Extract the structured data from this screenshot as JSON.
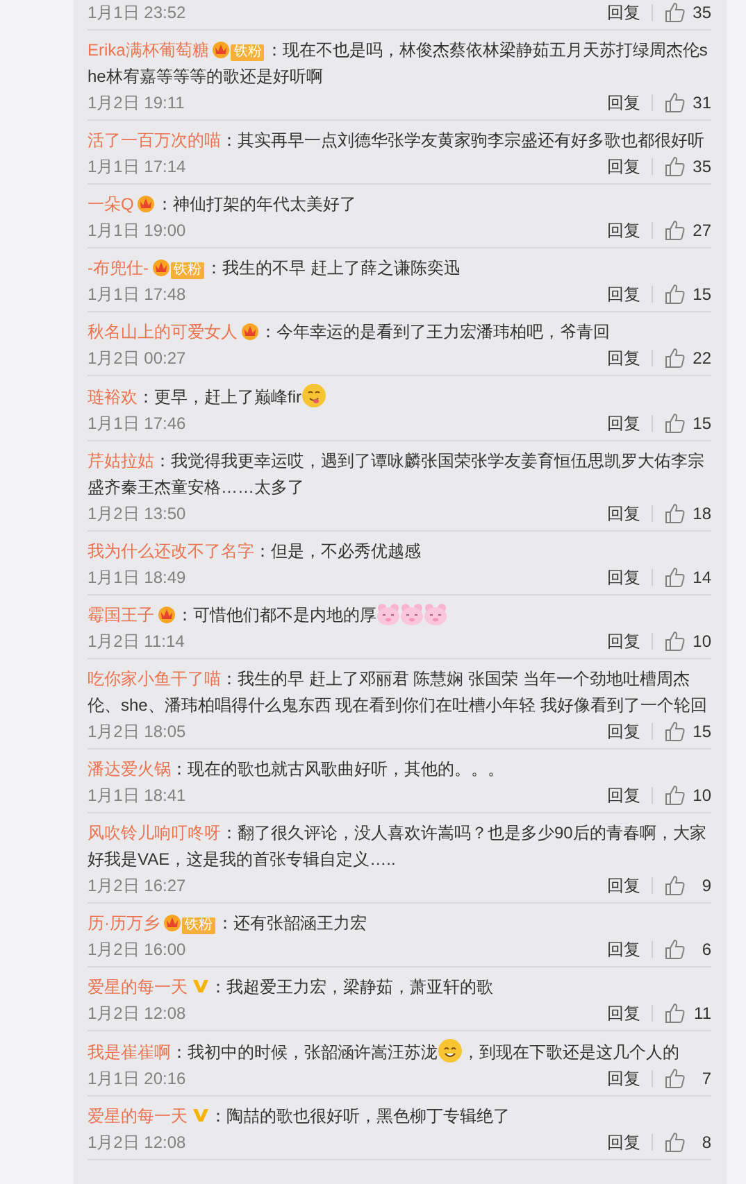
{
  "comments": [
    {
      "date": "1月1日 23:52",
      "reply": "回复",
      "likes": "35"
    },
    {
      "user": "Erika满杯葡萄糖",
      "badges": [
        {
          "kind": "crown"
        },
        {
          "kind": "fan",
          "label": "铁粉"
        }
      ],
      "body": [
        {
          "kind": "text",
          "text": "：现在不也是吗，林俊杰蔡依林梁静茹五月天苏打绿周杰伦she林宥嘉等等等的歌还是好听啊"
        }
      ],
      "date": "1月2日 19:11",
      "reply": "回复",
      "likes": "31"
    },
    {
      "user": "活了一百万次的喵",
      "body": [
        {
          "kind": "text",
          "text": "：其实再早一点刘德华张学友黄家驹李宗盛还有好多歌也都很好听"
        }
      ],
      "date": "1月1日 17:14",
      "reply": "回复",
      "likes": "35"
    },
    {
      "user": "一朵Q",
      "badges": [
        {
          "kind": "crown"
        }
      ],
      "body": [
        {
          "kind": "text",
          "text": "：神仙打架的年代太美好了"
        }
      ],
      "date": "1月1日 19:00",
      "reply": "回复",
      "likes": "27"
    },
    {
      "user": "-布兜仕-",
      "badges": [
        {
          "kind": "crown"
        },
        {
          "kind": "fan",
          "label": "铁粉"
        }
      ],
      "body": [
        {
          "kind": "text",
          "text": "：我生的不早 赶上了薛之谦陈奕迅"
        }
      ],
      "date": "1月1日 17:48",
      "reply": "回复",
      "likes": "15"
    },
    {
      "user": "秋名山上的可爱女人",
      "badges": [
        {
          "kind": "crown"
        }
      ],
      "body": [
        {
          "kind": "text",
          "text": "：今年幸运的是看到了王力宏潘玮柏吧，爷青回"
        }
      ],
      "date": "1月2日 00:27",
      "reply": "回复",
      "likes": "22"
    },
    {
      "user": "琏裕欢",
      "body": [
        {
          "kind": "text",
          "text": "：更早，赶上了巅峰fir"
        },
        {
          "kind": "yum"
        }
      ],
      "date": "1月1日 17:46",
      "reply": "回复",
      "likes": "15"
    },
    {
      "user": "芹姑拉姑",
      "body": [
        {
          "kind": "text",
          "text": "：我觉得我更幸运哎，遇到了谭咏麟张国荣张学友姜育恒伍思凯罗大佑李宗盛齐秦王杰童安格……太多了"
        }
      ],
      "date": "1月2日 13:50",
      "reply": "回复",
      "likes": "18"
    },
    {
      "user": "我为什么还改不了名字",
      "body": [
        {
          "kind": "text",
          "text": "：但是，不必秀优越感"
        }
      ],
      "date": "1月1日 18:49",
      "reply": "回复",
      "likes": "14"
    },
    {
      "user": "霉国王子",
      "badges": [
        {
          "kind": "crown"
        }
      ],
      "body": [
        {
          "kind": "text",
          "text": "：可惜他们都不是内地的厚"
        },
        {
          "kind": "pig"
        },
        {
          "kind": "pig"
        },
        {
          "kind": "pig"
        }
      ],
      "date": "1月2日 11:14",
      "reply": "回复",
      "likes": "10"
    },
    {
      "user": "吃你家小鱼干了喵",
      "body": [
        {
          "kind": "text",
          "text": "：我生的早 赶上了邓丽君 陈慧娴 张国荣 当年一个劲地吐槽周杰伦、she、潘玮柏唱得什么鬼东西 现在看到你们在吐槽小年轻 我好像看到了一个轮回"
        }
      ],
      "date": "1月2日 18:05",
      "reply": "回复",
      "likes": "15"
    },
    {
      "user": "潘达爱火锅",
      "body": [
        {
          "kind": "text",
          "text": "：现在的歌也就古风歌曲好听，其他的。。。"
        }
      ],
      "date": "1月1日 18:41",
      "reply": "回复",
      "likes": "10"
    },
    {
      "user": "风吹铃儿响叮咚呀",
      "body": [
        {
          "kind": "text",
          "text": "：翻了很久评论，没人喜欢许嵩吗？也是多少90后的青春啊，大家好我是VAE，这是我的首张专辑自定义….."
        }
      ],
      "date": "1月2日 16:27",
      "reply": "回复",
      "likes": "9"
    },
    {
      "user": "历·历万乡",
      "badges": [
        {
          "kind": "crown"
        },
        {
          "kind": "fan",
          "label": "铁粉"
        }
      ],
      "body": [
        {
          "kind": "text",
          "text": "：还有张韶涵王力宏"
        }
      ],
      "date": "1月2日 16:00",
      "reply": "回复",
      "likes": "6"
    },
    {
      "user": "爱星的每一天",
      "badges": [
        {
          "kind": "verified"
        }
      ],
      "body": [
        {
          "kind": "text",
          "text": "：我超爱王力宏，梁静茹，萧亚轩的歌"
        }
      ],
      "date": "1月2日 12:08",
      "reply": "回复",
      "likes": "11"
    },
    {
      "user": "我是崔崔啊",
      "body": [
        {
          "kind": "text",
          "text": "：我初中的时候，张韶涵许嵩汪苏泷"
        },
        {
          "kind": "smile"
        },
        {
          "kind": "text",
          "text": "，到现在下歌还是这几个人的"
        }
      ],
      "date": "1月1日 20:16",
      "reply": "回复",
      "likes": "7"
    },
    {
      "user": "爱星的每一天",
      "badges": [
        {
          "kind": "verified"
        }
      ],
      "body": [
        {
          "kind": "text",
          "text": "：陶喆的歌也很好听，黑色柳丁专辑绝了"
        }
      ],
      "date": "1月2日 12:08",
      "reply": "回复",
      "likes": "8"
    }
  ]
}
